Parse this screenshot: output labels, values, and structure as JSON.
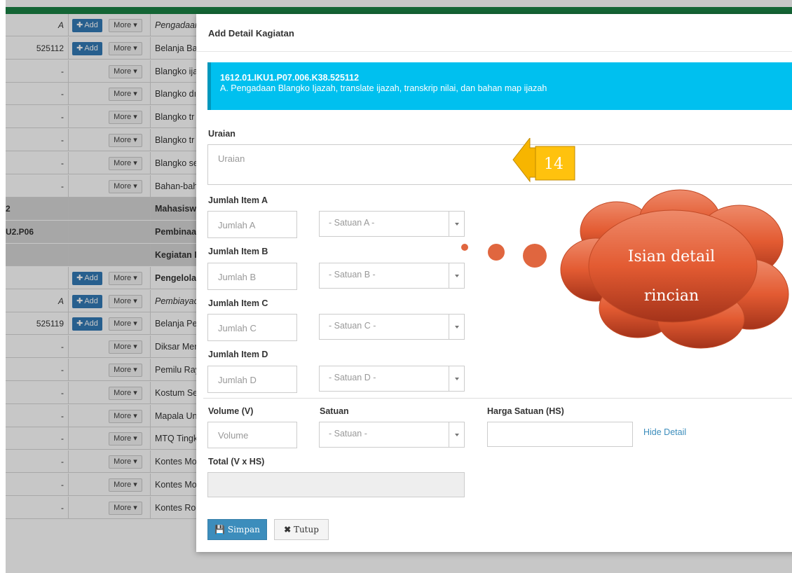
{
  "colors": {
    "topbar": "#1a8244",
    "primary": "#337ab7",
    "callout": "#00c0ef",
    "annotation_arrow": "#f7b500",
    "cloud": "#d9542e"
  },
  "table": {
    "add_label": "Add",
    "more_label": "More",
    "rows": [
      {
        "c1": "A",
        "c3": "Pengadaan",
        "btns": "both",
        "style": "italic"
      },
      {
        "c1": "525112",
        "c3": "Belanja Ba",
        "btns": "both",
        "style": ""
      },
      {
        "c1": "-",
        "c3": "Blangko ija",
        "btns": "more",
        "style": ""
      },
      {
        "c1": "-",
        "c3": "Blangko dı",
        "btns": "more",
        "style": ""
      },
      {
        "c1": "-",
        "c3": "Blangko tr",
        "btns": "more",
        "style": ""
      },
      {
        "c1": "-",
        "c3": "Blangko tr",
        "btns": "more",
        "style": ""
      },
      {
        "c1": "-",
        "c3": "Blangko se",
        "btns": "more",
        "style": ""
      },
      {
        "c1": "-",
        "c3": "Bahan-bah",
        "btns": "more",
        "style": ""
      },
      {
        "c1": "2",
        "c3": "Mahasisw",
        "btns": "none",
        "style": "gray"
      },
      {
        "c1": "U2.P06",
        "c3": "Pembinaa",
        "btns": "none",
        "style": "gray"
      },
      {
        "c1": "",
        "c3": "Kegiatan I",
        "btns": "none",
        "style": "gray"
      },
      {
        "c1": "",
        "c3": "Pengelola",
        "btns": "both",
        "style": "bold"
      },
      {
        "c1": "A",
        "c3": "Pembiayac",
        "btns": "both",
        "style": "italic"
      },
      {
        "c1": "525119",
        "c3": "Belanja Pe",
        "btns": "both",
        "style": ""
      },
      {
        "c1": "-",
        "c3": "Diksar Mer",
        "btns": "more",
        "style": ""
      },
      {
        "c1": "-",
        "c3": "Pemilu Ray",
        "btns": "more",
        "style": ""
      },
      {
        "c1": "-",
        "c3": "Kostum Se",
        "btns": "more",
        "style": ""
      },
      {
        "c1": "-",
        "c3": "Mapala Un",
        "btns": "more",
        "style": ""
      },
      {
        "c1": "-",
        "c3": "MTQ Tingk",
        "btns": "more",
        "style": ""
      },
      {
        "c1": "-",
        "c3": "Kontes Mo",
        "btns": "more",
        "style": ""
      },
      {
        "c1": "-",
        "c3": "Kontes Mo",
        "btns": "more",
        "style": ""
      },
      {
        "c1": "-",
        "c3": "Kontes Robot Terbang Indonesia",
        "btns": "more",
        "style": ""
      }
    ]
  },
  "modal": {
    "title": "Add Detail Kagiatan",
    "callout_code": "1612.01.IKU1.P07.006.K38.525112",
    "callout_desc": "A. Pengadaan Blangko Ijazah, translate ijazah, transkrip nilai, dan bahan map ijazah",
    "uraian_label": "Uraian",
    "uraian_placeholder": "Uraian",
    "items": [
      {
        "label": "Jumlah Item A",
        "placeholder": "Jumlah A",
        "select": "- Satuan A -"
      },
      {
        "label": "Jumlah Item B",
        "placeholder": "Jumlah B",
        "select": "- Satuan B -"
      },
      {
        "label": "Jumlah Item C",
        "placeholder": "Jumlah C",
        "select": "- Satuan C -"
      },
      {
        "label": "Jumlah Item D",
        "placeholder": "Jumlah D",
        "select": "- Satuan D -"
      }
    ],
    "volume_label": "Volume (V)",
    "volume_placeholder": "Volume",
    "satuan_label": "Satuan",
    "satuan_select": "- Satuan -",
    "harga_label": "Harga Satuan (HS)",
    "harga_value": "",
    "hide_detail": "Hide Detail",
    "total_label": "Total (V x HS)",
    "total_value": "",
    "save_label": "Simpan",
    "close_label": "Tutup"
  },
  "annotation": {
    "number": "14",
    "cloud_line1": "Isian detail",
    "cloud_line2": "rincian"
  }
}
